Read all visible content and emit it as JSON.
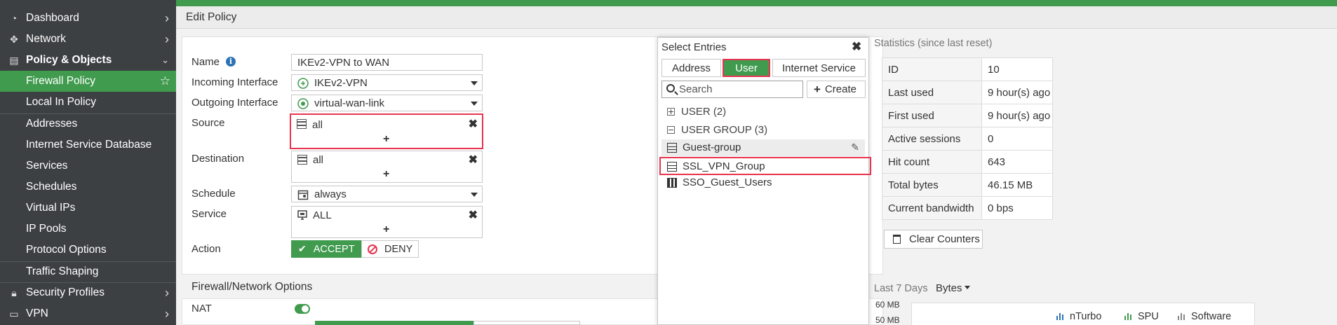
{
  "sidebar": {
    "items": [
      {
        "label": "Dashboard",
        "icon": "dashboard-icon"
      },
      {
        "label": "Network",
        "icon": "network-icon"
      },
      {
        "label": "Policy & Objects",
        "icon": "policy-icon"
      },
      {
        "label": "Firewall Policy"
      },
      {
        "label": "Local In Policy"
      },
      {
        "label": "Addresses"
      },
      {
        "label": "Internet Service Database"
      },
      {
        "label": "Services"
      },
      {
        "label": "Schedules"
      },
      {
        "label": "Virtual IPs"
      },
      {
        "label": "IP Pools"
      },
      {
        "label": "Protocol Options"
      },
      {
        "label": "Traffic Shaping"
      },
      {
        "label": "Security Profiles",
        "icon": "lock-icon"
      },
      {
        "label": "VPN",
        "icon": "laptop-icon"
      }
    ],
    "colors": {
      "bg": "#3d4043",
      "active": "#419b4f"
    }
  },
  "header": {
    "title": "Edit Policy"
  },
  "form": {
    "name": {
      "label": "Name",
      "value": "IKEv2-VPN to WAN"
    },
    "incoming": {
      "label": "Incoming Interface",
      "value": "IKEv2-VPN"
    },
    "outgoing": {
      "label": "Outgoing Interface",
      "value": "virtual-wan-link"
    },
    "source": {
      "label": "Source",
      "value": "all",
      "add": "+"
    },
    "destination": {
      "label": "Destination",
      "value": "all",
      "add": "+"
    },
    "schedule": {
      "label": "Schedule",
      "value": "always"
    },
    "service": {
      "label": "Service",
      "value": "ALL",
      "add": "+"
    },
    "action": {
      "label": "Action",
      "accept": "ACCEPT",
      "deny": "DENY"
    },
    "section": "Firewall/Network Options",
    "nat": {
      "label": "NAT"
    }
  },
  "popup": {
    "title": "Select Entries",
    "tabs": [
      "Address",
      "User",
      "Internet Service"
    ],
    "search_placeholder": "Search",
    "create": "Create",
    "groups": [
      "USER (2)",
      "USER GROUP (3)"
    ],
    "entries": [
      "Guest-group",
      "SSL_VPN_Group",
      "SSO_Guest_Users"
    ]
  },
  "stats": {
    "title": "Statistics (since last reset)",
    "rows": [
      {
        "k": "ID",
        "v": "10"
      },
      {
        "k": "Last used",
        "v": "9 hour(s) ago"
      },
      {
        "k": "First used",
        "v": "9 hour(s) ago"
      },
      {
        "k": "Active sessions",
        "v": "0"
      },
      {
        "k": "Hit count",
        "v": "643"
      },
      {
        "k": "Total bytes",
        "v": "46.15 MB"
      },
      {
        "k": "Current bandwidth",
        "v": "0 bps"
      }
    ],
    "clear": "Clear Counters",
    "period": "Last 7 Days",
    "unit": "Bytes",
    "y_labels": [
      "60 MB",
      "50 MB"
    ],
    "legend": [
      "nTurbo",
      "SPU",
      "Software"
    ]
  },
  "colors": {
    "accent": "#419b4f",
    "highlight": "#e8344e",
    "info": "#2c74b3"
  }
}
